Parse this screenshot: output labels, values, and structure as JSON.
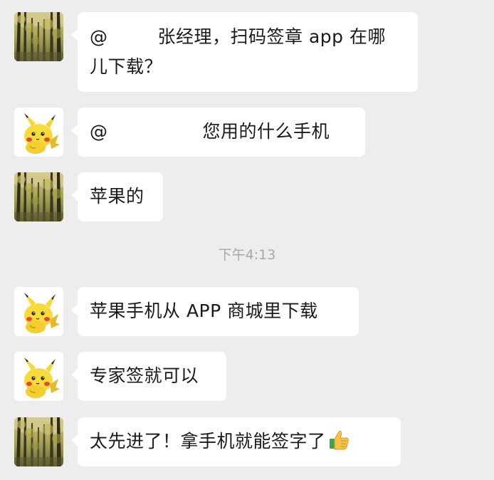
{
  "timestamp": "下午4:13",
  "messages": [
    {
      "sender": "forest-user",
      "mention": "@",
      "line1": "张经理，扫码签章 app 在哪",
      "line2": "儿下载？"
    },
    {
      "sender": "pikachu-user",
      "mention": "@",
      "text": "您用的什么手机"
    },
    {
      "sender": "forest-user",
      "text": "苹果的"
    },
    {
      "sender": "pikachu-user",
      "text": "苹果手机从 APP 商城里下载"
    },
    {
      "sender": "pikachu-user",
      "text": "专家签就可以"
    },
    {
      "sender": "forest-user",
      "text": "太先进了！拿手机就能签字了",
      "emoji": "thumbs-up-emoji"
    }
  ],
  "colors": {
    "background": "#ededed",
    "bubble": "#ffffff",
    "text": "#1a1a1a",
    "timestamp": "#a8a8a8"
  }
}
